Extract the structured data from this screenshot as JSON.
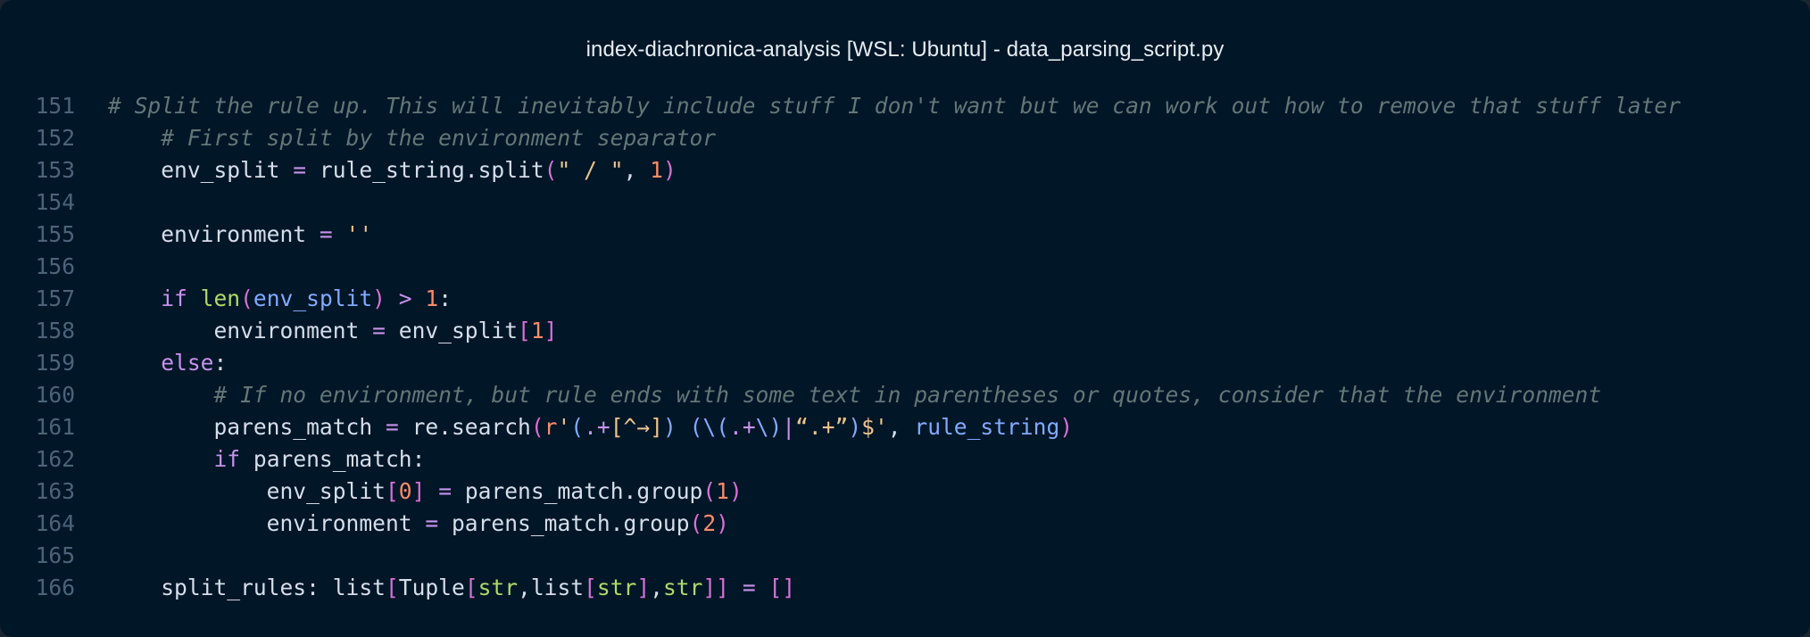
{
  "window": {
    "title": "index-diachronica-analysis [WSL: Ubuntu] - data_parsing_script.py"
  },
  "editor": {
    "lines": [
      {
        "number": "151",
        "tokens": [
          {
            "t": "# Split the rule up. This will inevitably include stuff I don't want but we can work out how to remove that stuff later",
            "c": "comment"
          }
        ]
      },
      {
        "number": "152",
        "tokens": [
          {
            "t": "    # First split by the environment separator",
            "c": "comment"
          }
        ]
      },
      {
        "number": "153",
        "tokens": [
          {
            "t": "    env_split ",
            "c": "var"
          },
          {
            "t": "=",
            "c": "op"
          },
          {
            "t": " rule_string.",
            "c": "var"
          },
          {
            "t": "split",
            "c": "var"
          },
          {
            "t": "(",
            "c": "bracket"
          },
          {
            "t": "\" ",
            "c": "string"
          },
          {
            "t": "/",
            "c": "string"
          },
          {
            "t": " \"",
            "c": "string"
          },
          {
            "t": ", ",
            "c": "punct"
          },
          {
            "t": "1",
            "c": "number"
          },
          {
            "t": ")",
            "c": "bracket"
          }
        ]
      },
      {
        "number": "154",
        "tokens": []
      },
      {
        "number": "155",
        "tokens": [
          {
            "t": "    environment ",
            "c": "var"
          },
          {
            "t": "=",
            "c": "op"
          },
          {
            "t": " ",
            "c": "var"
          },
          {
            "t": "''",
            "c": "string"
          }
        ]
      },
      {
        "number": "156",
        "tokens": []
      },
      {
        "number": "157",
        "tokens": [
          {
            "t": "    ",
            "c": "var"
          },
          {
            "t": "if",
            "c": "keyword"
          },
          {
            "t": " ",
            "c": "var"
          },
          {
            "t": "len",
            "c": "builtin"
          },
          {
            "t": "(",
            "c": "bracket"
          },
          {
            "t": "env_split",
            "c": "param"
          },
          {
            "t": ")",
            "c": "bracket"
          },
          {
            "t": " ",
            "c": "var"
          },
          {
            "t": ">",
            "c": "op"
          },
          {
            "t": " ",
            "c": "var"
          },
          {
            "t": "1",
            "c": "number"
          },
          {
            "t": ":",
            "c": "punct"
          }
        ]
      },
      {
        "number": "158",
        "tokens": [
          {
            "t": "        environment ",
            "c": "var"
          },
          {
            "t": "=",
            "c": "op"
          },
          {
            "t": " env_split",
            "c": "var"
          },
          {
            "t": "[",
            "c": "bracket"
          },
          {
            "t": "1",
            "c": "number"
          },
          {
            "t": "]",
            "c": "bracket"
          }
        ]
      },
      {
        "number": "159",
        "tokens": [
          {
            "t": "    ",
            "c": "var"
          },
          {
            "t": "else",
            "c": "keyword"
          },
          {
            "t": ":",
            "c": "punct"
          }
        ]
      },
      {
        "number": "160",
        "tokens": [
          {
            "t": "        # If no environment, but rule ends with some text in parentheses or quotes, consider that the environment",
            "c": "comment"
          }
        ]
      },
      {
        "number": "161",
        "tokens": [
          {
            "t": "        parens_match ",
            "c": "var"
          },
          {
            "t": "=",
            "c": "op"
          },
          {
            "t": " re.",
            "c": "var"
          },
          {
            "t": "search",
            "c": "var"
          },
          {
            "t": "(",
            "c": "bracket"
          },
          {
            "t": "r",
            "c": "kw2"
          },
          {
            "t": "'",
            "c": "string"
          },
          {
            "t": "(",
            "c": "func"
          },
          {
            "t": ".+",
            "c": "op"
          },
          {
            "t": "[",
            "c": "string"
          },
          {
            "t": "^→",
            "c": "string"
          },
          {
            "t": "]",
            "c": "string"
          },
          {
            "t": ")",
            "c": "func"
          },
          {
            "t": " ",
            "c": "string"
          },
          {
            "t": "(",
            "c": "func"
          },
          {
            "t": "\\(",
            "c": "func"
          },
          {
            "t": ".+",
            "c": "op"
          },
          {
            "t": "\\)",
            "c": "func"
          },
          {
            "t": "|",
            "c": "op"
          },
          {
            "t": "“.+”",
            "c": "string"
          },
          {
            "t": ")",
            "c": "func"
          },
          {
            "t": "$'",
            "c": "string"
          },
          {
            "t": ", ",
            "c": "punct"
          },
          {
            "t": "rule_string",
            "c": "param"
          },
          {
            "t": ")",
            "c": "bracket"
          }
        ]
      },
      {
        "number": "162",
        "tokens": [
          {
            "t": "        ",
            "c": "var"
          },
          {
            "t": "if",
            "c": "keyword"
          },
          {
            "t": " parens_match:",
            "c": "var"
          }
        ]
      },
      {
        "number": "163",
        "tokens": [
          {
            "t": "            env_split",
            "c": "var"
          },
          {
            "t": "[",
            "c": "bracket"
          },
          {
            "t": "0",
            "c": "number"
          },
          {
            "t": "]",
            "c": "bracket"
          },
          {
            "t": " ",
            "c": "var"
          },
          {
            "t": "=",
            "c": "op"
          },
          {
            "t": " parens_match.",
            "c": "var"
          },
          {
            "t": "group",
            "c": "var"
          },
          {
            "t": "(",
            "c": "bracket"
          },
          {
            "t": "1",
            "c": "number"
          },
          {
            "t": ")",
            "c": "bracket"
          }
        ]
      },
      {
        "number": "164",
        "tokens": [
          {
            "t": "            environment ",
            "c": "var"
          },
          {
            "t": "=",
            "c": "op"
          },
          {
            "t": " parens_match.",
            "c": "var"
          },
          {
            "t": "group",
            "c": "var"
          },
          {
            "t": "(",
            "c": "bracket"
          },
          {
            "t": "2",
            "c": "number"
          },
          {
            "t": ")",
            "c": "bracket"
          }
        ]
      },
      {
        "number": "165",
        "tokens": []
      },
      {
        "number": "166",
        "tokens": [
          {
            "t": "    split_rules: list",
            "c": "var"
          },
          {
            "t": "[",
            "c": "bracket"
          },
          {
            "t": "Tuple",
            "c": "var"
          },
          {
            "t": "[",
            "c": "bracket"
          },
          {
            "t": "str",
            "c": "builtin"
          },
          {
            "t": ",list",
            "c": "var"
          },
          {
            "t": "[",
            "c": "bracket"
          },
          {
            "t": "str",
            "c": "builtin"
          },
          {
            "t": "]",
            "c": "bracket"
          },
          {
            "t": ",",
            "c": "var"
          },
          {
            "t": "str",
            "c": "builtin"
          },
          {
            "t": "]]",
            "c": "bracket"
          },
          {
            "t": " ",
            "c": "var"
          },
          {
            "t": "=",
            "c": "op"
          },
          {
            "t": " ",
            "c": "var"
          },
          {
            "t": "[]",
            "c": "bracket"
          }
        ]
      }
    ]
  }
}
